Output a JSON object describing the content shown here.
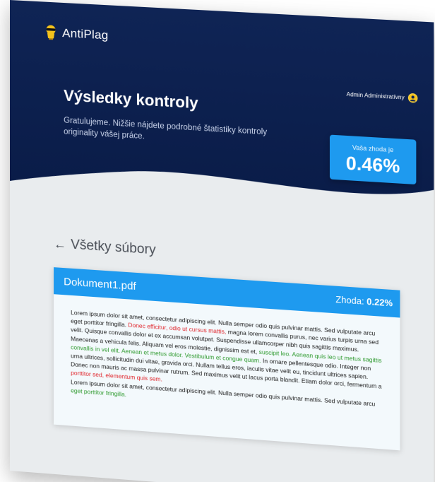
{
  "app": {
    "name": "AntiPlag"
  },
  "user": {
    "name": "Admin Administratívny"
  },
  "hero": {
    "title": "Výsledky kontroly",
    "subtitle": "Gratulujeme. Nižšie nájdete podrobné štatistiky kontroly originality vášej práce."
  },
  "match": {
    "label": "Vaša zhoda je",
    "value": "0.46%"
  },
  "back": {
    "label": "Všetky súbory"
  },
  "document": {
    "name": "Dokument1.pdf",
    "score_label": "Zhoda:",
    "score_value": "0.22%",
    "paragraph1": [
      {
        "text": "Lorem ipsum dolor sit amet, consectetur adipiscing elit. Nulla semper odio quis pulvinar mattis. Sed vulputate arcu eget porttitor fringilla. ",
        "style": "plain"
      },
      {
        "text": "Donec efficitur, odio ut cursus mattis,",
        "style": "red"
      },
      {
        "text": " magna lorem convallis purus, nec varius turpis urna sed velit. Quisque convallis dolor et ex accumsan volutpat. Suspendisse ullamcorper nibh quis sagittis maximus. Maecenas a vehicula felis. Aliquam vel eros molestie, dignissim est et, ",
        "style": "plain"
      },
      {
        "text": "suscipit leo. Aenean quis leo ut metus sagittis convallis in vel elit. Aenean et metus dolor. Vestibulum et congue quam.",
        "style": "green"
      },
      {
        "text": " In ornare pellentesque odio. Integer non urna ultrices, sollicitudin dui vitae, gravida orci. Nullam tellus eros, iaculis vitae velit eu, tincidunt ultrices sapien. Donec non mauris ac massa pulvinar rutrum. Sed maximus velit ut lacus porta blandit. Etiam dolor orci, fermentum a ",
        "style": "plain"
      },
      {
        "text": "porttitor sed, elementum quis sem.",
        "style": "red"
      }
    ],
    "paragraph2": [
      {
        "text": "Lorem ipsum dolor sit amet, consectetur adipiscing elit. Nulla semper odio quis pulvinar mattis. Sed vulputate arcu ",
        "style": "plain"
      },
      {
        "text": "eget porttitor fringilla.",
        "style": "green"
      }
    ]
  },
  "colors": {
    "hero_bg": "#0f2455",
    "accent": "#1e9aef",
    "match_red": "#e0252b",
    "match_green": "#2e9a2e",
    "page_bg": "#e9ecee"
  },
  "icons": {
    "logo": "masked-bandit-icon",
    "avatar": "user-avatar-icon",
    "back": "arrow-left-icon"
  }
}
